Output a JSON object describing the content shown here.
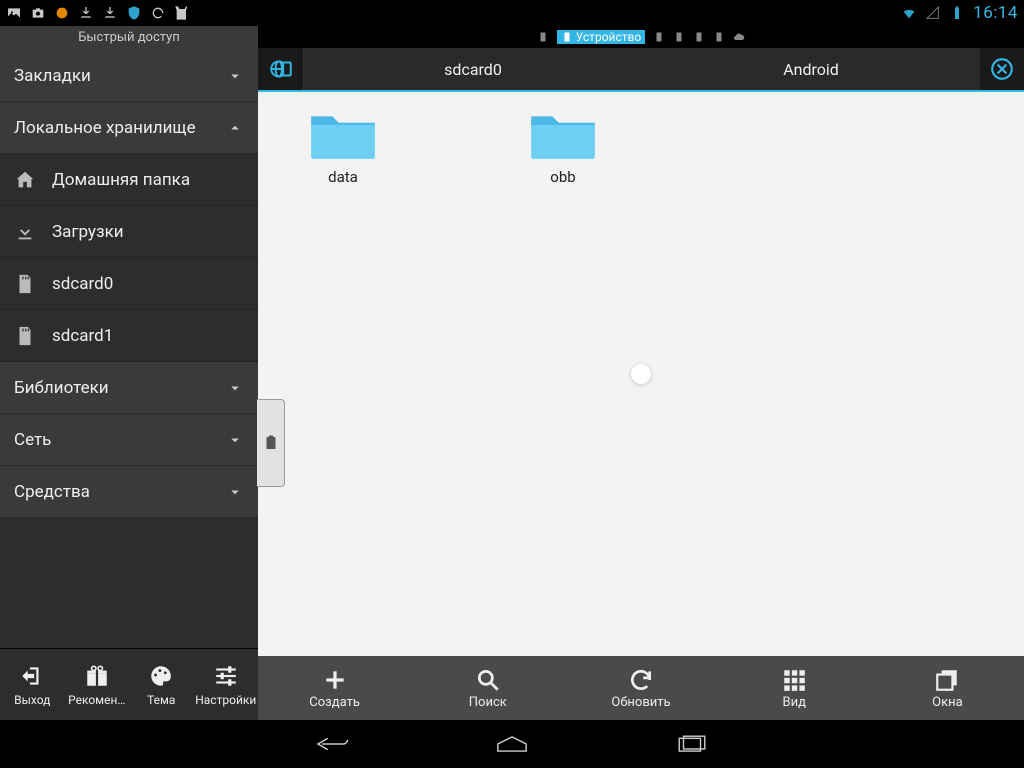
{
  "status_bar": {
    "time": "16:14"
  },
  "tabs": {
    "active_label": "Устройство"
  },
  "sidebar": {
    "title": "Быстрый доступ",
    "sections": {
      "bookmarks": "Закладки",
      "local_storage": "Локальное хранилище",
      "libraries": "Библиотеки",
      "network": "Сеть",
      "tools": "Средства"
    },
    "items": {
      "home": "Домашняя папка",
      "downloads": "Загрузки",
      "sdcard0": "sdcard0",
      "sdcard1": "sdcard1"
    },
    "bottom": {
      "exit": "Выход",
      "recommended": "Рекомен…",
      "theme": "Тема",
      "settings": "Настройки"
    }
  },
  "breadcrumb": {
    "seg1": "sdcard0",
    "seg2": "Android"
  },
  "folders": {
    "data": "data",
    "obb": "obb"
  },
  "toolbar": {
    "create": "Создать",
    "search": "Поиск",
    "refresh": "Обновить",
    "view": "Вид",
    "windows": "Окна"
  }
}
